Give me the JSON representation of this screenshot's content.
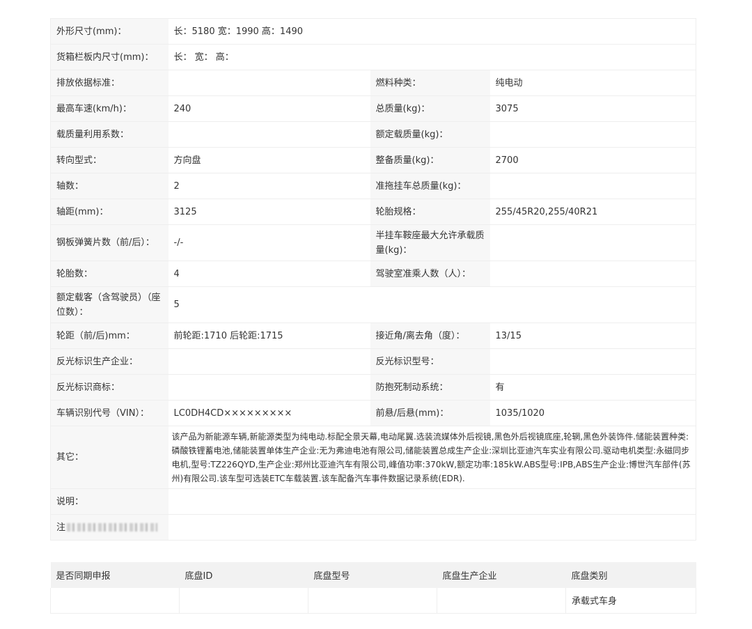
{
  "spec": {
    "dims_label": "外形尺寸(mm)：",
    "dims_value": "长：5180 宽：1990 高：1490",
    "cargo_label": "货箱栏板内尺寸(mm)：",
    "cargo_value": "长：  宽：  高：",
    "emission_label": "排放依据标准：",
    "emission_value": "",
    "fuel_label": "燃料种类：",
    "fuel_value": "纯电动",
    "speed_label": "最高车速(km/h)：",
    "speed_value": "240",
    "total_mass_label": "总质量(kg)：",
    "total_mass_value": "3075",
    "load_coef_label": "载质量利用系数：",
    "load_coef_value": "",
    "rated_load_label": "额定载质量(kg)：",
    "rated_load_value": "",
    "steering_label": "转向型式：",
    "steering_value": "方向盘",
    "curb_mass_label": "整备质量(kg)：",
    "curb_mass_value": "2700",
    "axles_label": "轴数：",
    "axles_value": "2",
    "trailer_label": "准拖挂车总质量(kg)：",
    "trailer_value": "",
    "wheelbase_label": "轴距(mm)：",
    "wheelbase_value": "3125",
    "tire_spec_label": "轮胎规格：",
    "tire_spec_value": "255/45R20,255/40R21",
    "spring_label": "钢板弹簧片数（前/后）：",
    "spring_value": "-/-",
    "saddle_label": "半挂车鞍座最大允许承载质量(kg)：",
    "saddle_value": "",
    "tires_label": "轮胎数：",
    "tires_value": "4",
    "cab_label": "驾驶室准乘人数（人）：",
    "cab_value": "",
    "seats_label": "额定载客（含驾驶员）（座位数）：",
    "seats_value": "5",
    "track_label": "轮距（前/后)mm：",
    "track_value": "前轮距:1710 后轮距:1715",
    "angle_label": "接近角/离去角（度）：",
    "angle_value": "13/15",
    "reflect_maker_label": "反光标识生产企业：",
    "reflect_maker_value": "",
    "reflect_model_label": "反光标识型号：",
    "reflect_model_value": "",
    "reflect_brand_label": "反光标识商标：",
    "reflect_brand_value": "",
    "abs_label": "防抱死制动系统：",
    "abs_value": "有",
    "vin_label": "车辆识别代号（VIN）：",
    "vin_value": "LC0DH4CD×××××××××",
    "overhang_label": "前悬/后悬(mm)：",
    "overhang_value": "1035/1020",
    "other_label": "其它：",
    "other_value": "该产品为新能源车辆,新能源类型为纯电动.标配全景天幕,电动尾翼.选装流媒体外后视镜,黑色外后视镜底座,轮辋,黑色外装饰件.储能装置种类:磷酸铁锂蓄电池,储能装置单体生产企业:无为弗迪电池有限公司,储能装置总成生产企业:深圳比亚迪汽车实业有限公司.驱动电机类型:永磁同步电机,型号:TZ226QYD,生产企业:郑州比亚迪汽车有限公司,峰值功率:370kW,额定功率:185kW.ABS型号:IPB,ABS生产企业:博世汽车部件(苏州)有限公司.该车型可选装ETC车载装置.该车配备汽车事件数据记录系统(EDR).",
    "note_label": "说明：",
    "note_value": "",
    "last_label": "注",
    "last_value": ""
  },
  "chassis": {
    "headers": [
      "是否同期申报",
      "底盘ID",
      "底盘型号",
      "底盘生产企业",
      "底盘类别"
    ],
    "row": [
      "",
      "",
      "",
      "",
      "承载式车身"
    ]
  }
}
